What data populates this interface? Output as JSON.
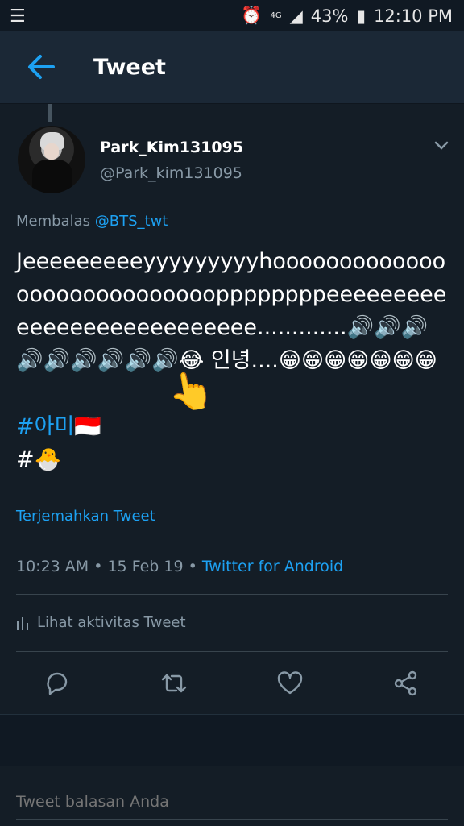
{
  "status_bar": {
    "menu_icon": "list-icon",
    "alarm_icon": "alarm-clock-icon",
    "network": "4G",
    "battery_percent": "43%",
    "time": "12:10 PM"
  },
  "header": {
    "title": "Tweet",
    "back_icon": "arrow-left-icon"
  },
  "tweet": {
    "display_name": "Park_Kim131095",
    "handle": "@Park_kim131095",
    "replying_prefix": "Membalas",
    "replying_to": "@BTS_twt",
    "body_main": "Jeeeeeeeeeyyyyyyyyyhooooooooooooooooooooooooooooppppppppeeeeeeeeeeeeeeeeeeeeeeeeeee.............🔊🔊🔊🔊🔊🔊🔊🔊🔊😂 인녕....😁😁😁😁😁😁😁",
    "hashtag1": "#아미🇮🇩",
    "hashtag2_prefix": "#",
    "hashtag2_emoji": "🐣",
    "pointing_emoji": "👆",
    "translate_link": "Terjemahkan Tweet",
    "timestamp": "10:23 AM • 15 Feb 19 •",
    "source": "Twitter for Android",
    "activity": "Lihat aktivitas Tweet"
  },
  "actions": {
    "reply": "reply-icon",
    "retweet": "retweet-icon",
    "like": "heart-icon",
    "share": "share-icon"
  },
  "reply_box": {
    "placeholder": "Tweet balasan Anda"
  },
  "colors": {
    "background": "#141d26",
    "header": "#1b2836",
    "accent": "#1da1f2",
    "secondary_text": "#8899a6",
    "divider": "#38444d"
  }
}
